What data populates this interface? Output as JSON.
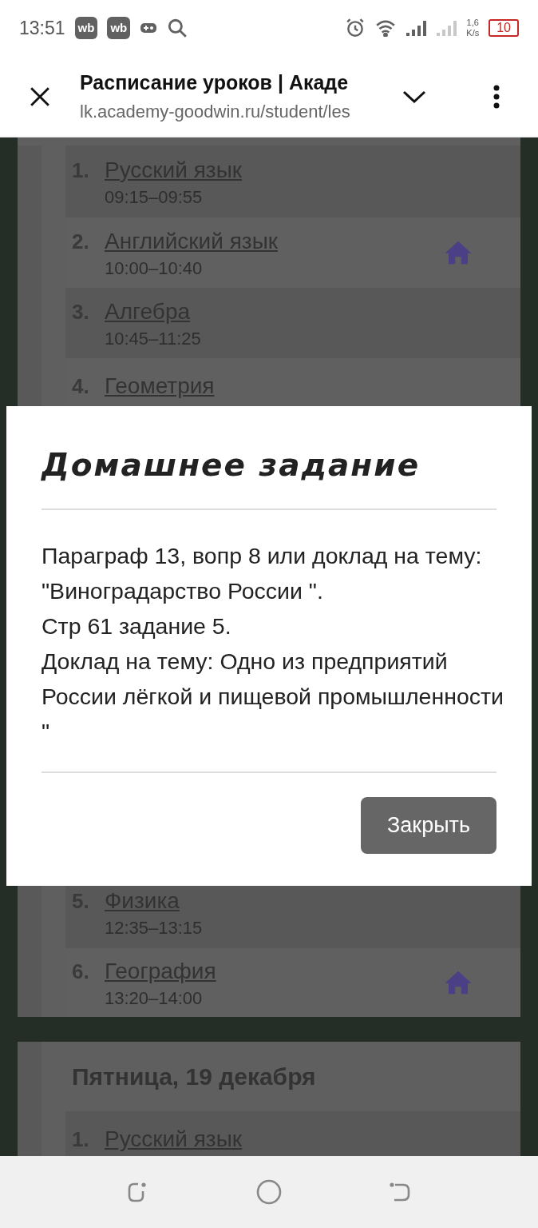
{
  "status_bar": {
    "time": "13:51",
    "app_badges": [
      "wb",
      "wb"
    ],
    "network_speed": [
      "1,6",
      "K/s"
    ],
    "battery": "10"
  },
  "browser": {
    "title": "Расписание уроков | Акаде",
    "url": "lk.academy-goodwin.ru/student/les"
  },
  "day_card_top": {
    "lessons": [
      {
        "number": "1.",
        "name": "Русский язык",
        "time": "09:15–09:55",
        "homework": false
      },
      {
        "number": "2.",
        "name": "Английский язык",
        "time": "10:00–10:40",
        "homework": true
      },
      {
        "number": "3.",
        "name": "Алгебра",
        "time": "10:45–11:25",
        "homework": false
      },
      {
        "number": "4.",
        "name": "Геометрия",
        "homework": false
      }
    ]
  },
  "dialog": {
    "title": "Домашнее задание",
    "lines": [
      "Параграф 13, вопр 8 или доклад на тему: \"Виноградарство России \".",
      "Стр 61 задание 5.",
      "Доклад на тему: Одно из предприятий России лёгкой и пищевой промышленности \""
    ],
    "close_button": "Закрыть"
  },
  "day_card_bottom": {
    "lessons": [
      {
        "number": "5.",
        "name": "Физика",
        "time": "12:35–13:15",
        "homework": false
      },
      {
        "number": "6.",
        "name": "География",
        "time": "13:20–14:00",
        "homework": true
      }
    ]
  },
  "next_day": {
    "title": "Пятница, 19 декабря",
    "lessons": [
      {
        "number": "1.",
        "name": "Русский язык",
        "homework": false
      }
    ]
  }
}
